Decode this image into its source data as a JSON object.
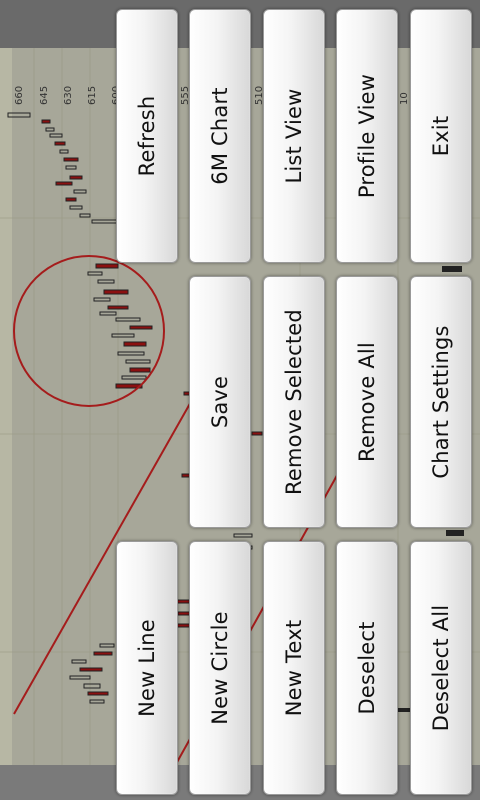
{
  "chart": {
    "price_labels": [
      "660",
      "645",
      "630",
      "615",
      "600",
      "555",
      "510",
      "10"
    ]
  },
  "menu": {
    "row_top": [
      {
        "name": "refresh-button",
        "label": "Refresh"
      },
      {
        "name": "six-month-chart-button",
        "label": "6M Chart"
      },
      {
        "name": "list-view-button",
        "label": "List View"
      },
      {
        "name": "profile-view-button",
        "label": "Profile View"
      },
      {
        "name": "exit-button",
        "label": "Exit"
      }
    ],
    "row_middle": [
      {
        "name": "save-button",
        "label": "Save"
      },
      {
        "name": "remove-selected-button",
        "label": "Remove Selected"
      },
      {
        "name": "remove-all-button",
        "label": "Remove All"
      },
      {
        "name": "chart-settings-button",
        "label": "Chart Settings"
      }
    ],
    "row_bottom": [
      {
        "name": "new-line-button",
        "label": "New Line"
      },
      {
        "name": "new-circle-button",
        "label": "New Circle"
      },
      {
        "name": "new-text-button",
        "label": "New Text"
      },
      {
        "name": "deselect-button",
        "label": "Deselect"
      },
      {
        "name": "deselect-all-button",
        "label": "Deselect All"
      }
    ]
  },
  "colors": {
    "chart_bg": "#cdcdb6",
    "drawing_red": "#a51c1c",
    "candle_down": "#8b1010"
  }
}
